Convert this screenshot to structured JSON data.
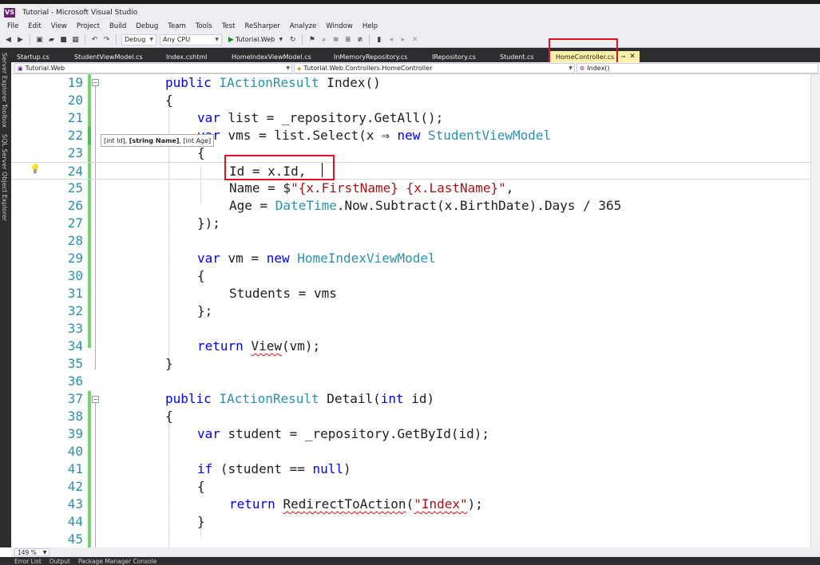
{
  "window": {
    "title": "Tutorial - Microsoft Visual Studio",
    "logo_text": "VS"
  },
  "menu": [
    "File",
    "Edit",
    "View",
    "Project",
    "Build",
    "Debug",
    "Team",
    "Tools",
    "Test",
    "ReSharper",
    "Analyze",
    "Window",
    "Help"
  ],
  "toolbar": {
    "configuration": "Debug",
    "platform": "Any CPU",
    "start_target": "Tutorial.Web"
  },
  "sidebar_panels": [
    "Server Explorer",
    "Toolbox",
    "SQL Server Object Explorer"
  ],
  "tabs": [
    {
      "label": "Startup.cs"
    },
    {
      "label": "StudentViewModel.cs"
    },
    {
      "label": "Index.cshtml"
    },
    {
      "label": "HomeIndexViewModel.cs"
    },
    {
      "label": "InMemoryRepository.cs"
    },
    {
      "label": "IRepository.cs"
    },
    {
      "label": "Student.cs"
    },
    {
      "label": "HomeController.cs",
      "active": true
    }
  ],
  "navigation": {
    "project": "Tutorial.Web",
    "type": "Tutorial.Web.Controllers.HomeController",
    "member": "Index()"
  },
  "editor": {
    "lines": [
      {
        "num": "19",
        "text": "public IActionResult Index()"
      },
      {
        "num": "20",
        "text": "{"
      },
      {
        "num": "21",
        "text": "var list = _repository.GetAll();"
      },
      {
        "num": "22",
        "text": "var vms = list.Select(x ⇒ new StudentViewModel"
      },
      {
        "num": "23",
        "text": "{"
      },
      {
        "num": "24",
        "text": "Id = x.Id,"
      },
      {
        "num": "25",
        "text": "Name = $\"{x.FirstName} {x.LastName}\","
      },
      {
        "num": "26",
        "text": "Age = DateTime.Now.Subtract(x.BirthDate).Days / 365"
      },
      {
        "num": "27",
        "text": "});"
      },
      {
        "num": "28",
        "text": ""
      },
      {
        "num": "29",
        "text": "var vm = new HomeIndexViewModel"
      },
      {
        "num": "30",
        "text": "{"
      },
      {
        "num": "31",
        "text": "Students = vms"
      },
      {
        "num": "32",
        "text": "};"
      },
      {
        "num": "33",
        "text": ""
      },
      {
        "num": "34",
        "text": "return View(vm);"
      },
      {
        "num": "35",
        "text": "}"
      },
      {
        "num": "36",
        "text": ""
      },
      {
        "num": "37",
        "text": "public IActionResult Detail(int id)"
      },
      {
        "num": "38",
        "text": "{"
      },
      {
        "num": "39",
        "text": "var student = _repository.GetById(id);"
      },
      {
        "num": "40",
        "text": ""
      },
      {
        "num": "41",
        "text": "if (student == null)"
      },
      {
        "num": "42",
        "text": "{"
      },
      {
        "num": "43",
        "text": "return RedirectToAction(\"Index\");"
      },
      {
        "num": "44",
        "text": "}"
      },
      {
        "num": "45",
        "text": ""
      }
    ],
    "tooltip": {
      "before": "[int Id], ",
      "bold": "[string Name]",
      "after": ", [int Age]"
    }
  },
  "status": {
    "zoom": "149 %"
  },
  "bottom_tabs": [
    "Error List",
    "Output",
    "Package Manager Console"
  ],
  "colors": {
    "keyword": "#0000ff",
    "type": "#2b91af",
    "string": "#a31515",
    "line_number": "#2b91af",
    "highlight_box": "#e81123",
    "active_tab": "#fff1a8"
  }
}
